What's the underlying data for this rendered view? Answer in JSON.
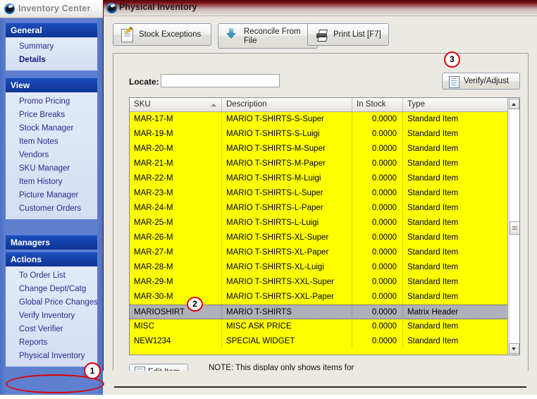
{
  "nav": {
    "title": "Inventory Center",
    "logo_icon": "app-logo-icon",
    "groups": [
      {
        "header": "General",
        "items": [
          {
            "label": "Summary",
            "bold": false
          },
          {
            "label": "Details",
            "bold": true
          }
        ]
      },
      {
        "header": "View",
        "items": [
          {
            "label": "Promo Pricing",
            "bold": false
          },
          {
            "label": "Price Breaks",
            "bold": false
          },
          {
            "label": "Stock Manager",
            "bold": false
          },
          {
            "label": "Item Notes",
            "bold": false
          },
          {
            "label": "Vendors",
            "bold": false
          },
          {
            "label": "SKU Manager",
            "bold": false
          },
          {
            "label": "Item History",
            "bold": false
          },
          {
            "label": "Picture Manager",
            "bold": false
          },
          {
            "label": "Customer Orders",
            "bold": false
          }
        ]
      },
      {
        "header": "Managers",
        "items": []
      },
      {
        "header": "Actions",
        "items": [
          {
            "label": "To Order List",
            "bold": false
          },
          {
            "label": "Change Dept/Catg",
            "bold": false
          },
          {
            "label": "Global Price Changes",
            "bold": false
          },
          {
            "label": "Verify Inventory",
            "bold": false
          },
          {
            "label": "Cost Verifier",
            "bold": false
          },
          {
            "label": "Reports",
            "bold": false
          },
          {
            "label": "Physical Inventory",
            "bold": false
          }
        ]
      }
    ]
  },
  "window": {
    "title": "Physical Inventory",
    "logo_icon": "app-logo-icon"
  },
  "toolbar": {
    "stock_exceptions": "Stock Exceptions",
    "reconcile_from_file": "Reconcile From\nFile",
    "print_list": "Print List [F7]"
  },
  "locate": {
    "label": "Locate:",
    "value": "",
    "placeholder": ""
  },
  "verify_adjust": {
    "label": "Verify/Adjust"
  },
  "grid": {
    "columns": [
      "SKU",
      "Description",
      "In Stock",
      "Type"
    ],
    "sort_column": "SKU",
    "sort_direction": "ascending",
    "rows": [
      {
        "sku": "MAR-17-M",
        "description": "MARIO T-SHIRTS-S-Super",
        "in_stock": "0.0000",
        "type": "Standard Item",
        "selected": false
      },
      {
        "sku": "MAR-19-M",
        "description": "MARIO T-SHIRTS-S-Luigi",
        "in_stock": "0.0000",
        "type": "Standard Item",
        "selected": false
      },
      {
        "sku": "MAR-20-M",
        "description": "MARIO T-SHIRTS-M-Super",
        "in_stock": "0.0000",
        "type": "Standard Item",
        "selected": false
      },
      {
        "sku": "MAR-21-M",
        "description": "MARIO T-SHIRTS-M-Paper",
        "in_stock": "0.0000",
        "type": "Standard Item",
        "selected": false
      },
      {
        "sku": "MAR-22-M",
        "description": "MARIO T-SHIRTS-M-Luigi",
        "in_stock": "0.0000",
        "type": "Standard Item",
        "selected": false
      },
      {
        "sku": "MAR-23-M",
        "description": "MARIO T-SHIRTS-L-Super",
        "in_stock": "0.0000",
        "type": "Standard Item",
        "selected": false
      },
      {
        "sku": "MAR-24-M",
        "description": "MARIO T-SHIRTS-L-Paper",
        "in_stock": "0.0000",
        "type": "Standard Item",
        "selected": false
      },
      {
        "sku": "MAR-25-M",
        "description": "MARIO T-SHIRTS-L-Luigi",
        "in_stock": "0.0000",
        "type": "Standard Item",
        "selected": false
      },
      {
        "sku": "MAR-26-M",
        "description": "MARIO T-SHIRTS-XL-Super",
        "in_stock": "0.0000",
        "type": "Standard Item",
        "selected": false
      },
      {
        "sku": "MAR-27-M",
        "description": "MARIO T-SHIRTS-XL-Paper",
        "in_stock": "0.0000",
        "type": "Standard Item",
        "selected": false
      },
      {
        "sku": "MAR-28-M",
        "description": "MARIO T-SHIRTS-XL-Luigi",
        "in_stock": "0.0000",
        "type": "Standard Item",
        "selected": false
      },
      {
        "sku": "MAR-29-M",
        "description": "MARIO T-SHIRTS-XXL-Super",
        "in_stock": "0.0000",
        "type": "Standard Item",
        "selected": false
      },
      {
        "sku": "MAR-30-M",
        "description": "MARIO T-SHIRTS-XXL-Paper",
        "in_stock": "0.0000",
        "type": "Standard Item",
        "selected": false
      },
      {
        "sku": "MARIOSHIRT",
        "description": "MARIO T-SHIRTS",
        "in_stock": "0.0000",
        "type": "Matrix Header",
        "selected": true
      },
      {
        "sku": "MISC",
        "description": "MISC ASK PRICE",
        "in_stock": "0.0000",
        "type": "Standard Item",
        "selected": false
      },
      {
        "sku": "NEW1234",
        "description": "SPECIAL WIDGET",
        "in_stock": "0.0000",
        "type": "Standard Item",
        "selected": false
      }
    ]
  },
  "footer": {
    "edit_item": "Edit Item",
    "note": "NOTE: This display only shows items for\nwhich Stock Tracking is turned ON."
  },
  "annotations": [
    {
      "number": "1",
      "target": "Physical Inventory"
    },
    {
      "number": "2",
      "target": "MARIOSHIRT row"
    },
    {
      "number": "3",
      "target": "Verify/Adjust"
    }
  ],
  "colors": {
    "row_highlight": "#ffff00",
    "row_selected": "#b0b0b8",
    "nav_header": "#1540a8",
    "nav_panel": "#5f7fcf",
    "annotation": "#e00000",
    "titlebar": "#7b1016"
  }
}
